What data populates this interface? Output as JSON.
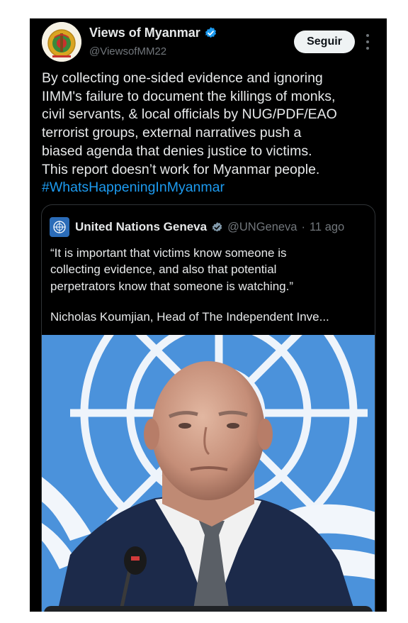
{
  "post": {
    "author_name": "Views of Myanmar",
    "author_handle": "@ViewsofMM22",
    "follow_label": "Seguir",
    "text_lines": [
      "By collecting one-sided evidence and ignoring",
      "IIMM's failure to document the killings of monks,",
      "civil servants, & local officials by NUG/PDF/EAO",
      "terrorist groups, external narratives push a",
      "biased agenda that denies justice to victims.",
      "This report doesn’t work for Myanmar people."
    ],
    "hashtag": "#WhatsHappeningInMyanmar"
  },
  "quoted_post": {
    "author_name": "United Nations Geneva",
    "author_handle": "@UNGeneva",
    "separator": "·",
    "time": "11 ago",
    "text_lines": [
      "“It is important that victims know someone is",
      "collecting evidence, and also that potential",
      "perpetrators know that someone is watching.”"
    ],
    "attribution": "Nicholas Koumjian, Head of The Independent Inve..."
  },
  "icons": {
    "verified": "verified-badge-icon",
    "more": "more-options-icon"
  },
  "colors": {
    "background": "#000000",
    "text": "#e7e9ea",
    "secondary_text": "#71767b",
    "link": "#1d9bf0",
    "verified": "#1d9bf0",
    "un_blue": "#4b92db"
  }
}
